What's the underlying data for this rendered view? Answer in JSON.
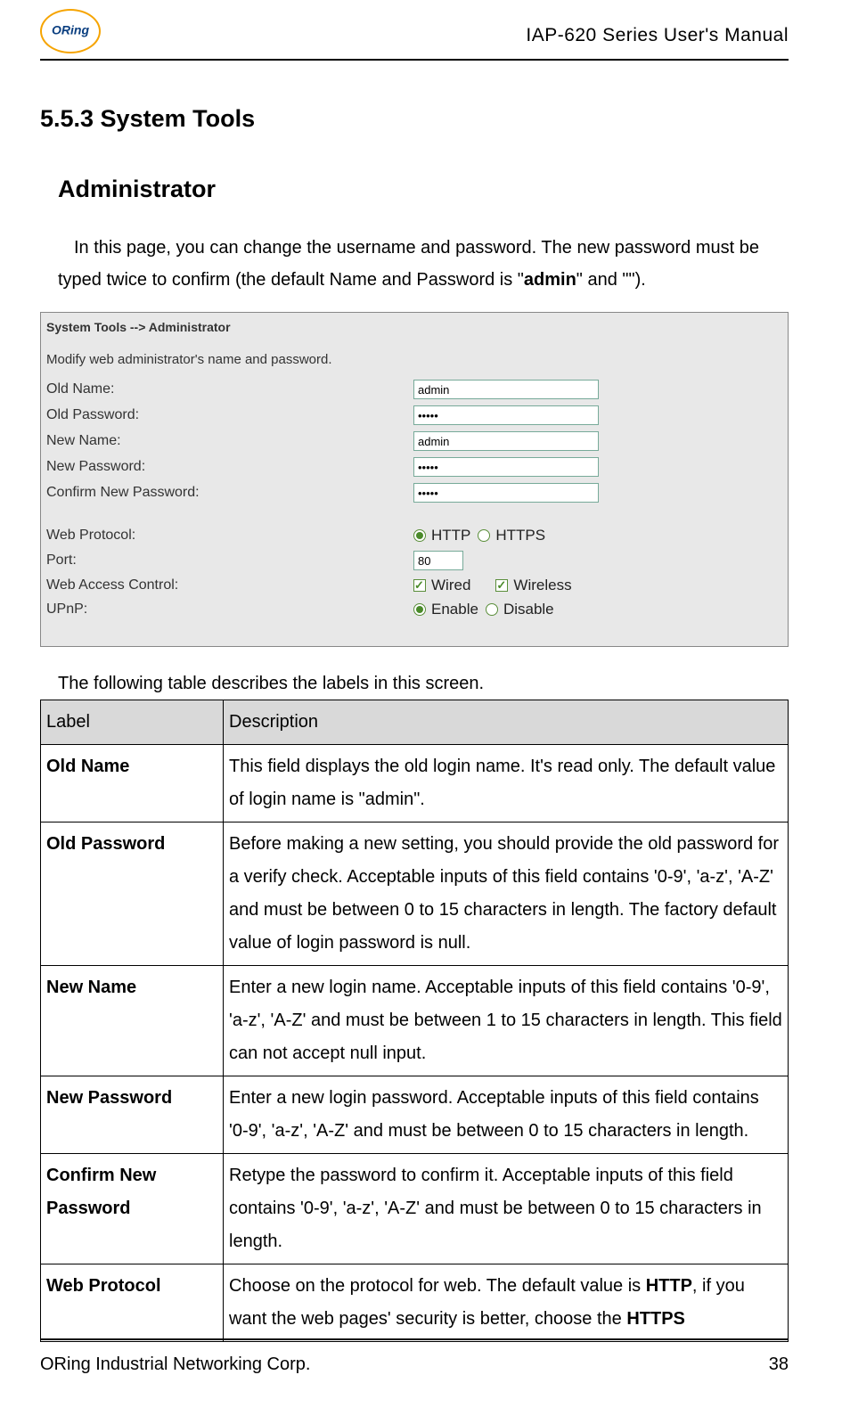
{
  "header": {
    "logo_text": "ORing",
    "manual_title": "IAP-620 Series User's Manual"
  },
  "section": {
    "number_title": "5.5.3  System Tools",
    "subheading": "Administrator",
    "intro_prefix": "In this page, you can change the username and password.    The new password must be typed twice to confirm (the default Name and Password is \"",
    "intro_bold": "admin",
    "intro_suffix": "\" and \"\")."
  },
  "screenshot": {
    "breadcrumb": "System Tools --> Administrator",
    "description": "Modify web administrator's name and password.",
    "fields": {
      "old_name_label": "Old Name:",
      "old_name_value": "admin",
      "old_password_label": "Old Password:",
      "old_password_value": "•••••",
      "new_name_label": "New Name:",
      "new_name_value": "admin",
      "new_password_label": "New Password:",
      "new_password_value": "•••••",
      "confirm_password_label": "Confirm New Password:",
      "confirm_password_value": "•••••",
      "web_protocol_label": "Web Protocol:",
      "http_label": "HTTP",
      "https_label": "HTTPS",
      "port_label": "Port:",
      "port_value": "80",
      "web_access_label": "Web Access Control:",
      "wired_label": "Wired",
      "wireless_label": "Wireless",
      "upnp_label": "UPnP:",
      "enable_label": "Enable",
      "disable_label": "Disable"
    }
  },
  "table": {
    "caption": "The following table describes the labels in this screen.",
    "header_label": "Label",
    "header_desc": "Description",
    "rows": [
      {
        "label": "Old Name",
        "desc": "This field displays the old login name.    It's read only. The default value of login name is \"admin\"."
      },
      {
        "label": "Old Password",
        "desc": "Before making a new setting, you should provide the old password for a verify check.    Acceptable inputs of this field contains '0-9', 'a-z', 'A-Z' and must be between 0 to 15 characters in length.    The factory default value of login password is null."
      },
      {
        "label": "New Name",
        "desc": "Enter a new login name.    Acceptable inputs of this field contains '0-9', 'a-z', 'A-Z' and must be between 1 to 15 characters in length. This field can not accept null input."
      },
      {
        "label": "New Password",
        "desc": "Enter a new login password.    Acceptable inputs of this field contains '0-9', 'a-z', 'A-Z' and must be between 0 to 15 characters in length."
      },
      {
        "label": "Confirm New Password",
        "desc": "Retype the password to confirm it.    Acceptable inputs of this field contains '0-9', 'a-z', 'A-Z' and must be between 0 to 15 characters in length."
      },
      {
        "label": "Web Protocol",
        "desc_prefix": "Choose on the protocol for web.    The default value is ",
        "desc_bold1": "HTTP",
        "desc_mid": ", if you want the web pages' security is better, choose the ",
        "desc_bold2": "HTTPS"
      }
    ]
  },
  "footer": {
    "company": "ORing Industrial Networking Corp.",
    "page_number": "38"
  }
}
